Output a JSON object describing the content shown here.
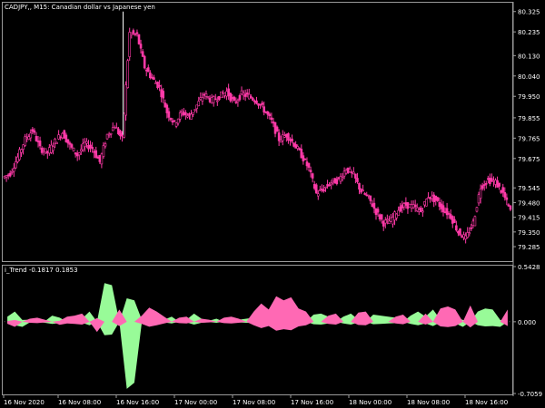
{
  "symbol_title": "CADJPY,, M15:  Canadian dollar vs Japanese yen",
  "indicator_title": "i_Trend -0.1817 0.1853",
  "colors": {
    "background": "#000000",
    "candle": "#ff3aa8",
    "axis": "#9a9a9a",
    "text": "#ffffff",
    "bull": "#98fb98",
    "bear": "#ff69b4"
  },
  "chart_data": [
    {
      "type": "candlestick",
      "title": "CADJPY,, M15:  Canadian dollar vs Japanese yen",
      "ylim": [
        79.225,
        80.36
      ],
      "y_ticks": [
        "80.325",
        "80.235",
        "80.130",
        "80.040",
        "79.950",
        "79.855",
        "79.765",
        "79.675",
        "79.585",
        "79.495",
        "79.400",
        "79.305"
      ],
      "price_axis_values": [
        80.325,
        80.235,
        80.13,
        80.04,
        79.95,
        79.855,
        79.765,
        79.675,
        79.585,
        79.495,
        79.4,
        79.305
      ],
      "price_axis_labels": [
        "80.325",
        "80.235",
        "80.130",
        "80.040",
        "79.950",
        "79.855",
        "79.765",
        "79.675",
        "79.545",
        "79.480",
        "79.415",
        "79.350",
        "79.285"
      ],
      "x_ticks": [
        "16 Nov 2020",
        "16 Nov 08:00",
        "16 Nov 16:00",
        "17 Nov 00:00",
        "17 Nov 08:00",
        "17 Nov 16:00",
        "18 Nov 00:00",
        "18 Nov 08:00",
        "18 Nov 16:00"
      ],
      "close_path": [
        79.61,
        79.68,
        79.76,
        79.8,
        79.72,
        79.7,
        79.75,
        79.79,
        79.73,
        79.69,
        79.74,
        79.72,
        79.66,
        79.78,
        79.82,
        79.76,
        80.23,
        80.22,
        80.08,
        80.03,
        79.99,
        79.88,
        79.83,
        79.88,
        79.86,
        79.91,
        79.96,
        79.93,
        79.95,
        79.97,
        79.92,
        79.96,
        79.95,
        79.93,
        79.89,
        79.84,
        79.76,
        79.78,
        79.74,
        79.69,
        79.63,
        79.52,
        79.54,
        79.57,
        79.58,
        79.63,
        79.6,
        79.53,
        79.5,
        79.44,
        79.39,
        79.4,
        79.45,
        79.47,
        79.46,
        79.44,
        79.51,
        79.49,
        79.45,
        79.42,
        79.35,
        79.32,
        79.39,
        79.55,
        79.58,
        79.57,
        79.52,
        79.44
      ]
    },
    {
      "type": "area",
      "title": "i_Trend -0.1817 0.1853",
      "ylim": [
        -0.7059,
        0.5428
      ],
      "y_ticks": [
        "0.5428",
        "0.000",
        "-0.7059"
      ],
      "series": [
        {
          "name": "",
          "color": "#98fb98",
          "values": [
            0.05,
            0.1,
            -0.05,
            0.02,
            0.0,
            -0.01,
            0.06,
            0.04,
            0.0,
            0.02,
            0.03,
            0.1,
            0.0,
            0.38,
            0.36,
            0.0,
            -0.66,
            -0.6,
            0.02,
            0.0,
            0.0,
            0.02,
            0.05,
            0.0,
            0.02,
            0.08,
            0.03,
            0.01,
            0.03,
            0.0,
            0.0,
            0.02,
            0.03,
            0.04,
            0.0,
            0.05,
            0.07,
            0.06,
            0.03,
            0.04,
            0.0,
            0.07,
            0.08,
            0.05,
            0.0,
            0.05,
            0.08,
            0.02,
            0.0,
            0.07,
            0.06,
            0.05,
            0.04,
            0.0,
            0.06,
            0.1,
            0.05,
            0.12,
            0.02,
            0.04,
            0.05,
            -0.05,
            0.0,
            0.1,
            0.13,
            0.12,
            -0.05,
            0.0
          ]
        },
        {
          "name": "",
          "color": "#ff69b4",
          "values": [
            -0.02,
            -0.05,
            0.0,
            0.03,
            0.04,
            0.02,
            0.0,
            -0.03,
            0.05,
            0.06,
            0.08,
            0.0,
            -0.1,
            0.0,
            0.0,
            0.12,
            0.0,
            0.0,
            0.06,
            0.14,
            0.1,
            0.05,
            0.0,
            0.04,
            0.05,
            0.0,
            0.03,
            0.02,
            0.0,
            0.04,
            0.05,
            0.03,
            0.0,
            0.1,
            0.18,
            0.12,
            0.25,
            0.21,
            0.24,
            0.13,
            0.1,
            0.0,
            0.0,
            0.06,
            0.08,
            0.0,
            0.0,
            0.09,
            0.1,
            0.0,
            0.0,
            0.0,
            0.05,
            0.07,
            0.0,
            0.0,
            0.08,
            0.0,
            0.13,
            0.15,
            0.12,
            0.0,
            0.16,
            0.0,
            0.0,
            0.0,
            0.0,
            0.12
          ]
        }
      ]
    }
  ]
}
